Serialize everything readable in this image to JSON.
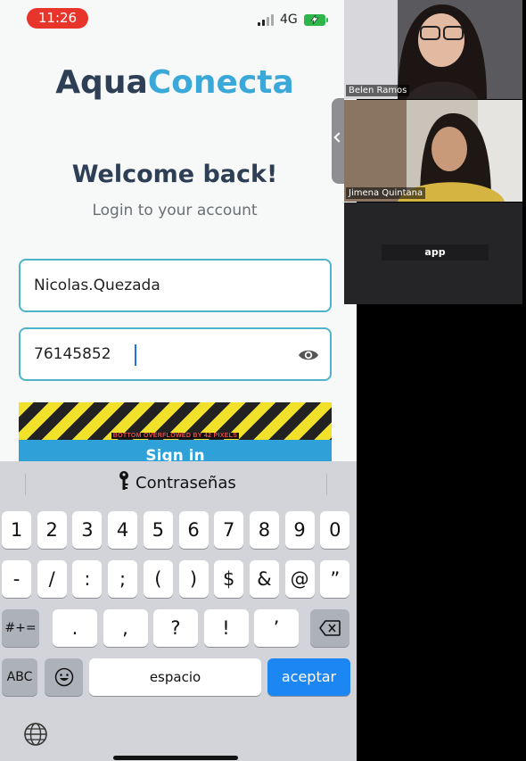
{
  "status_bar": {
    "time": "11:26",
    "network": "4G"
  },
  "app": {
    "logo_part1": "Aqua",
    "logo_part2": "Conecta",
    "welcome": "Welcome back!",
    "subtitle": "Login to your account",
    "username_value": "Nicolas.Quezada",
    "password_value": "76145852",
    "overflow_warning": "BOTTOM OVERFLOWED BY 42 PIXELS",
    "signin_label": "Sign in"
  },
  "keyboard": {
    "suggestion": "Contraseñas",
    "row1": [
      "1",
      "2",
      "3",
      "4",
      "5",
      "6",
      "7",
      "8",
      "9",
      "0"
    ],
    "row2": [
      "-",
      "/",
      ":",
      ";",
      "(",
      ")",
      "$",
      "&",
      "@",
      "”"
    ],
    "row3": [
      ".",
      ",",
      "?",
      "!",
      "’"
    ],
    "mode_key": "#+=",
    "abc_key": "ABC",
    "space_key": "espacio",
    "return_key": "aceptar"
  },
  "meeting": {
    "participant1": "Belen Ramos",
    "participant2": "Jimena Quintana",
    "app_tile": "app"
  },
  "colors": {
    "accent": "#3aa8d8",
    "brand_dark": "#2d3e55",
    "field_border": "#4fb3c9",
    "button": "#2fa0d8",
    "return_key": "#1c86f2",
    "time_pill": "#e8352b"
  }
}
